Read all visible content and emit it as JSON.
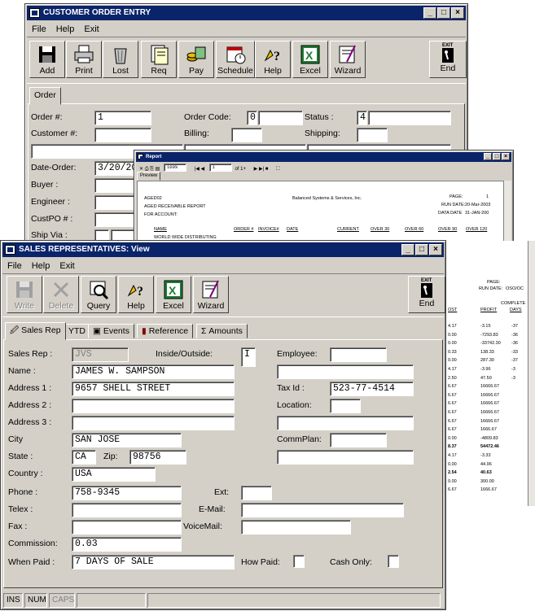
{
  "customer_window": {
    "title": "CUSTOMER ORDER ENTRY",
    "menu": [
      "File",
      "Help",
      "Exit"
    ],
    "toolbar": [
      "Add",
      "Print",
      "Lost",
      "Req",
      "Pay",
      "Schedule",
      "Help",
      "Excel",
      "Wizard",
      "End"
    ],
    "exit_caption": "EXIT",
    "tab": "Order",
    "labels": {
      "order_no": "Order  #:",
      "customer_no": "Customer #:",
      "order_code": "Order Code:",
      "billing": "Billing:",
      "status": "Status  :",
      "shipping": "Shipping:",
      "date_order": "Date-Order:",
      "buyer": "Buyer    :",
      "engineer": "Engineer   :",
      "custpo": "CustPO # :",
      "shipvia": "Ship Via :"
    },
    "values": {
      "order_no": "1",
      "order_code": "0",
      "status": "4",
      "date_order": "3/20/20"
    }
  },
  "report_window": {
    "title": "Report",
    "tab": "Preview",
    "zoom": "100%",
    "page": "1",
    "of": "of 1+",
    "header_left": [
      "AGED02",
      "AGED RECEIVABLE REPORT",
      "FOR ACCOUNT:"
    ],
    "header_center": "Balanced Systems & Services, Inc.",
    "header_right_labels": [
      "PAGE:",
      "RUN DATE:",
      "DATA DATE"
    ],
    "header_right_values": [
      "1",
      "20-Mar-2003",
      "31-JAN-200"
    ],
    "columns": [
      "NAME",
      "ORDER #",
      "INVOICE#",
      "DATE",
      "CURRENT",
      "OVER 30",
      "OVER 60",
      "OVER 90",
      "OVER 120"
    ],
    "first_row": "WORLD WIDE DISTRIBUTING",
    "right_header": [
      "PAGE:",
      "RUN DATE:",
      "COMPLETE",
      "OSO/OC"
    ],
    "right_cols": [
      "OST",
      "PROFIT",
      "DAYS"
    ],
    "right_rows": [
      [
        "4.17",
        "-3.15",
        "-37"
      ],
      [
        "0.00",
        "-7293.83",
        "-36"
      ],
      [
        "0.00",
        "-33742.30",
        "-36"
      ],
      [
        "0.33",
        "138.33",
        "-33"
      ],
      [
        "0.00",
        "287.30",
        "-37"
      ],
      [
        "4.17",
        "-3.96",
        "-3"
      ],
      [
        "2.50",
        "47.50",
        "-3"
      ],
      [
        "6.67",
        "16666.67",
        ""
      ],
      [
        "6.67",
        "16666.67",
        ""
      ],
      [
        "6.67",
        "16666.67",
        ""
      ],
      [
        "6.67",
        "16666.67",
        ""
      ],
      [
        "6.67",
        "16666.67",
        ""
      ],
      [
        "6.67",
        "1666.67",
        ""
      ],
      [
        "0.00",
        "-4809.83",
        ""
      ],
      [
        "8.37",
        "54472.46",
        ""
      ],
      [
        "4.17",
        "-3.33",
        ""
      ],
      [
        "0.00",
        "44.96",
        ""
      ],
      [
        "2.54",
        "40.63",
        ""
      ],
      [
        "0.00",
        "300.00",
        ""
      ],
      [
        "6.67",
        "1666.67",
        ""
      ]
    ]
  },
  "sales_window": {
    "title": "SALES REPRESENTATIVES: View",
    "menu": [
      "File",
      "Help",
      "Exit"
    ],
    "toolbar": [
      "Write",
      "Delete",
      "Query",
      "Help",
      "Excel",
      "Wizard",
      "End"
    ],
    "exit_caption": "EXIT",
    "tabs": [
      "Sales Rep",
      "YTD",
      "Events",
      "Reference",
      "Amounts"
    ],
    "labels": {
      "sales_rep": "Sales Rep :",
      "inside_outside": "Inside/Outside:",
      "employee": "Employee:",
      "name": "Name     :",
      "address1": "Address 1 :",
      "address2": "Address 2 :",
      "address3": "Address 3 :",
      "tax_id": "Tax Id  :",
      "location": "Location:",
      "city": "City",
      "state": "State     :",
      "zip": "Zip:",
      "commplan": "CommPlan:",
      "country": "Country   :",
      "phone": "Phone    :",
      "ext": "Ext:",
      "telex": "Telex     :",
      "email": "E-Mail:",
      "fax": "Fax       :",
      "voicemail": "VoiceMail:",
      "commission": "Commission:",
      "when_paid": "When Paid :",
      "how_paid": "How Paid:",
      "cash_only": "Cash Only:"
    },
    "values": {
      "sales_rep": "JVS",
      "inside_outside": "I",
      "name": "JAMES W. SAMPSON",
      "address1": "9657 SHELL STREET",
      "tax_id": "523-77-4514",
      "city": "SAN JOSE",
      "state": "CA",
      "zip": "98756",
      "country": "USA",
      "phone": "758-9345",
      "commission": "0.03",
      "when_paid": "7 DAYS OF SALE"
    },
    "status_bar": [
      "INS",
      "NUM",
      "CAPS"
    ]
  }
}
